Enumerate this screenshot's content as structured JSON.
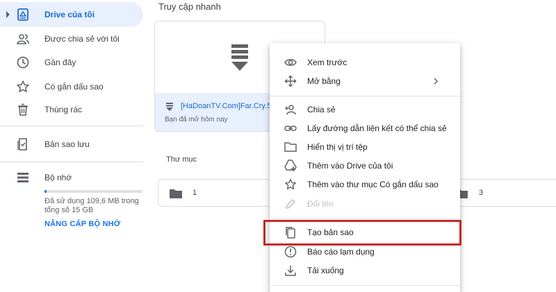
{
  "sidebar": {
    "items": [
      {
        "label": "Drive của tôi",
        "icon": "my-drive-icon"
      },
      {
        "label": "Được chia sẻ với tôi",
        "icon": "shared-people-icon"
      },
      {
        "label": "Gần đây",
        "icon": "clock-icon"
      },
      {
        "label": "Có gắn dấu sao",
        "icon": "star-icon"
      },
      {
        "label": "Thùng rác",
        "icon": "trash-icon"
      },
      {
        "label": "Bản sao lưu",
        "icon": "backup-icon"
      },
      {
        "label": "Bộ nhớ",
        "icon": "storage-icon"
      }
    ],
    "storage_used_fraction": 0.007,
    "storage_text": "Đã sử dụng 109,6 MB trong tổng số 15 GB",
    "upgrade_label": "NÂNG CẤP BỘ NHỚ"
  },
  "main": {
    "quick_access_title": "Truy cập nhanh",
    "quick_card": {
      "file_name": "[HaDoanTV.Com]Far.Cry.5",
      "subtitle": "Bạn đã mở hôm nay"
    },
    "folders_title": "Thư mục",
    "folders": [
      {
        "name": "1"
      },
      {
        "name": "3"
      }
    ]
  },
  "context_menu": {
    "items": [
      {
        "label": "Xem trước",
        "icon": "eye-icon"
      },
      {
        "label": "Mở bằng",
        "icon": "open-with-icon"
      },
      {
        "label": "Chia sẻ",
        "icon": "add-person-icon"
      },
      {
        "label": "Lấy đường dẫn liên kết có thể chia sẻ",
        "icon": "link-icon"
      },
      {
        "label": "Hiển thị vị trí tệp",
        "icon": "folder-icon"
      },
      {
        "label": "Thêm vào Drive của tôi",
        "icon": "add-to-drive-icon"
      },
      {
        "label": "Thêm vào thư mục Có gắn dấu sao",
        "icon": "star-icon"
      },
      {
        "label": "Đổi tên",
        "icon": "pencil-icon",
        "disabled": true
      },
      {
        "label": "Tạo bản sao",
        "icon": "copy-icon"
      },
      {
        "label": "Báo cáo lạm dụng",
        "icon": "report-icon"
      },
      {
        "label": "Tải xuống",
        "icon": "download-icon"
      }
    ]
  },
  "colors": {
    "accent": "#1a73e8",
    "active_bg": "#e8f0fe",
    "highlight_border": "#c62828"
  }
}
